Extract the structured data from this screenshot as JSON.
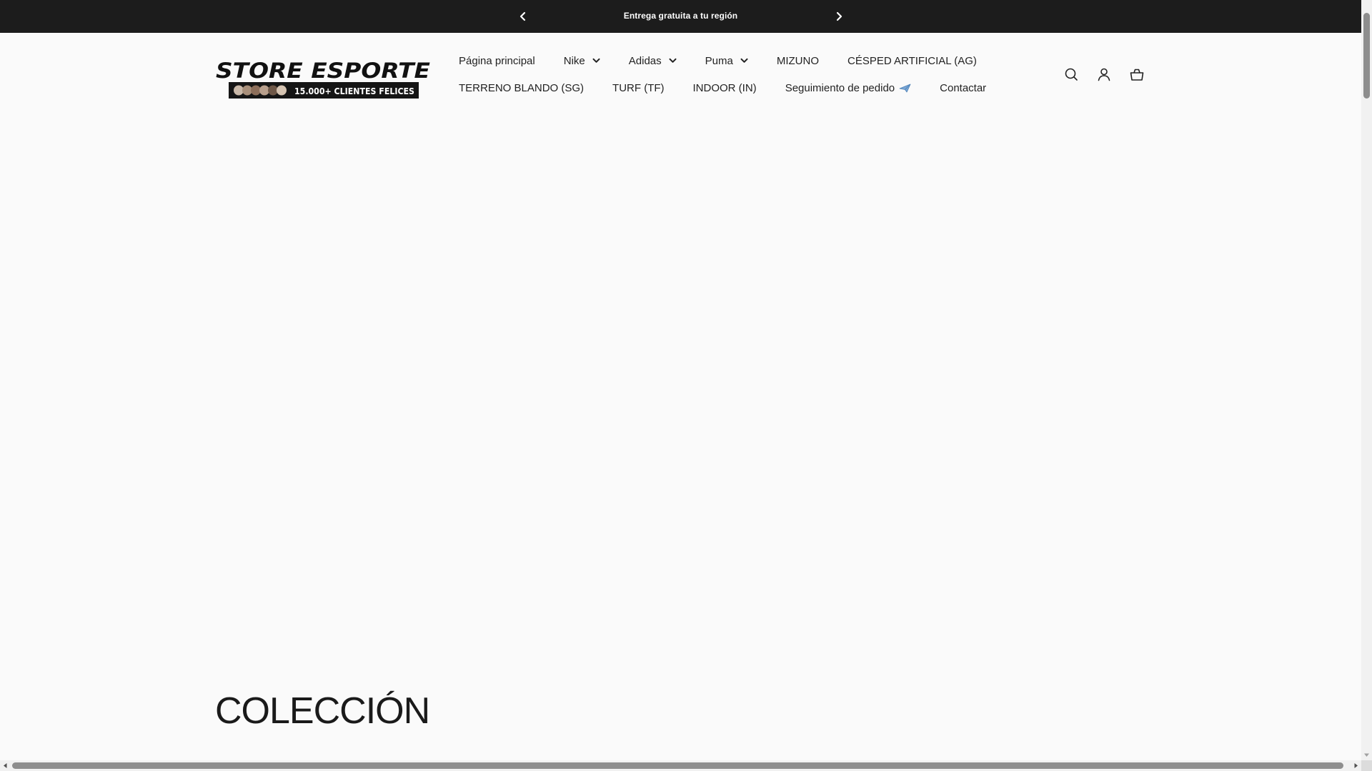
{
  "announcement": {
    "message": "Entrega gratuita a tu región",
    "prev_icon": "chevron-left-icon",
    "next_icon": "chevron-right-icon"
  },
  "logo": {
    "brand_text": "STORE ESPORTE",
    "badge_text": "15.000+ CLIENTES FELICES"
  },
  "nav": {
    "row1": [
      {
        "label": "Página principal",
        "dropdown": false
      },
      {
        "label": "Nike",
        "dropdown": true
      },
      {
        "label": "Adidas",
        "dropdown": true
      },
      {
        "label": "Puma",
        "dropdown": true
      },
      {
        "label": "MIZUNO",
        "dropdown": false
      },
      {
        "label": "CÉSPED ARTIFICIAL (AG)",
        "dropdown": false
      }
    ],
    "row2": [
      {
        "label": "TERRENO BLANDO (SG)",
        "dropdown": false
      },
      {
        "label": "TURF (TF)",
        "dropdown": false
      },
      {
        "label": "INDOOR (IN)",
        "dropdown": false
      },
      {
        "label": "Seguimiento de pedido",
        "dropdown": false,
        "icon": "airplane-emoji-icon"
      },
      {
        "label": "Contactar",
        "dropdown": false
      }
    ]
  },
  "header_icons": [
    "search-icon",
    "account-icon",
    "cart-icon"
  ],
  "collection": {
    "title": "COLECCIÓN"
  },
  "colors": {
    "announcement_bg": "#1c1c1c",
    "page_bg": "#fafafa",
    "text": "#1a1a1a"
  }
}
